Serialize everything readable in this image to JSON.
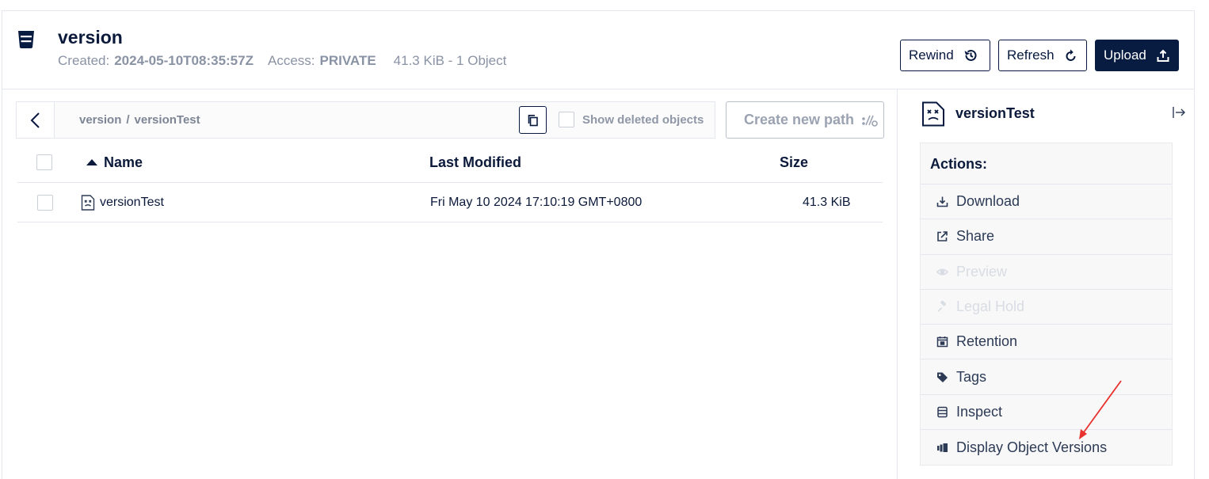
{
  "header": {
    "bucket_name": "version",
    "created_label": "Created:",
    "created_value": "2024-05-10T08:35:57Z",
    "access_label": "Access:",
    "access_value": "PRIVATE",
    "usage": "41.3 KiB - 1 Object",
    "buttons": {
      "rewind": "Rewind",
      "refresh": "Refresh",
      "upload": "Upload"
    }
  },
  "breadcrumb": {
    "items": [
      "version",
      "versionTest"
    ],
    "separator": "/",
    "show_deleted_label": "Show deleted objects",
    "show_deleted_checked": false
  },
  "create_path_button": "Create new path",
  "table": {
    "columns": [
      "Name",
      "Last Modified",
      "Size"
    ],
    "sort": {
      "column": "Name",
      "direction": "ascending"
    },
    "rows": [
      {
        "name": "versionTest",
        "last_modified": "Fri May 10 2024 17:10:19 GMT+0800",
        "size": "41.3 KiB",
        "checked": false
      }
    ]
  },
  "panel": {
    "title": "versionTest",
    "actions_title": "Actions:",
    "actions": [
      {
        "label": "Download",
        "icon": "download-icon",
        "enabled": true
      },
      {
        "label": "Share",
        "icon": "share-icon",
        "enabled": true
      },
      {
        "label": "Preview",
        "icon": "eye-icon",
        "enabled": false
      },
      {
        "label": "Legal Hold",
        "icon": "gavel-icon",
        "enabled": false
      },
      {
        "label": "Retention",
        "icon": "calendar-icon",
        "enabled": true
      },
      {
        "label": "Tags",
        "icon": "tag-icon",
        "enabled": true
      },
      {
        "label": "Inspect",
        "icon": "inspect-icon",
        "enabled": true
      },
      {
        "label": "Display Object Versions",
        "icon": "versions-icon",
        "enabled": true
      }
    ]
  },
  "colors": {
    "primary": "#081c42",
    "border": "#e4e7ee",
    "muted_text": "#8a93a4",
    "disabled_text": "#d8dce3",
    "annotation_arrow": "#e8322e"
  }
}
